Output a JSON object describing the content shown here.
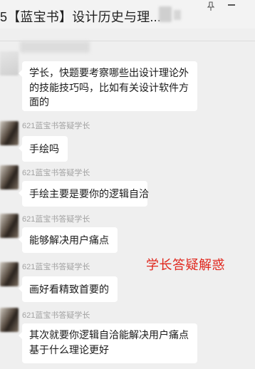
{
  "window": {
    "title": "5【蓝宝书】设计历史与理...",
    "pin_icon": "pin-icon",
    "minimize_icon": "minimize-icon"
  },
  "messages": [
    {
      "sender": "",
      "lines": [
        "学长，快题要考察哪些出设计理论外",
        "的技能技巧吗，比如有关设计软件方",
        "面的"
      ]
    },
    {
      "sender": "621蓝宝书答疑学长",
      "lines": [
        "手绘吗"
      ]
    },
    {
      "sender": "621蓝宝书答疑学长",
      "lines": [
        "手绘主要是要你的逻辑自洽"
      ]
    },
    {
      "sender": "621蓝宝书答疑学长",
      "lines": [
        "能够解决用户痛点"
      ]
    },
    {
      "sender": "621蓝宝书答疑学长",
      "lines": [
        "画好看精致首要的"
      ]
    },
    {
      "sender": "621蓝宝书答疑学长",
      "lines": [
        "其次就要你逻辑自洽能解决用户痛点",
        "基于什么理论更好"
      ]
    }
  ],
  "annotation": {
    "text": "学长答疑解惑",
    "color": "#e0261c"
  }
}
